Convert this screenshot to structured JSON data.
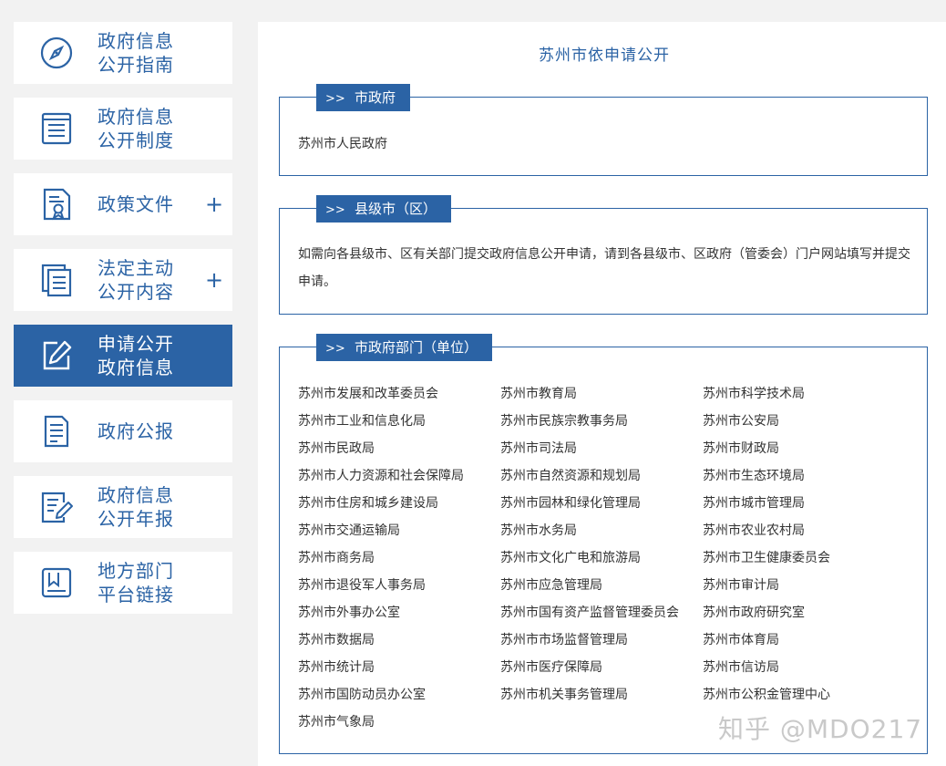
{
  "sidebar": {
    "items": [
      {
        "line1": "政府信息",
        "line2": "公开指南",
        "plus": ""
      },
      {
        "line1": "政府信息",
        "line2": "公开制度",
        "plus": ""
      },
      {
        "line1": "政策文件",
        "line2": "",
        "plus": "+"
      },
      {
        "line1": "法定主动",
        "line2": "公开内容",
        "plus": "+"
      },
      {
        "line1": "申请公开",
        "line2": "政府信息",
        "plus": ""
      },
      {
        "line1": "政府公报",
        "line2": "",
        "plus": ""
      },
      {
        "line1": "政府信息",
        "line2": "公开年报",
        "plus": ""
      },
      {
        "line1": "地方部门",
        "line2": "平台链接",
        "plus": ""
      }
    ]
  },
  "main": {
    "title": "苏州市依申请公开",
    "sections": [
      {
        "arrow": ">>",
        "label": "市政府",
        "text": "苏州市人民政府"
      },
      {
        "arrow": ">>",
        "label": "县级市（区）",
        "text": "如需向各县级市、区有关部门提交政府信息公开申请，请到各县级市、区政府（管委会）门户网站填写并提交申请。"
      },
      {
        "arrow": ">>",
        "label": "市政府部门（单位）",
        "departments": [
          "苏州市发展和改革委员会",
          "苏州市教育局",
          "苏州市科学技术局",
          "苏州市工业和信息化局",
          "苏州市民族宗教事务局",
          "苏州市公安局",
          "苏州市民政局",
          "苏州市司法局",
          "苏州市财政局",
          "苏州市人力资源和社会保障局",
          "苏州市自然资源和规划局",
          "苏州市生态环境局",
          "苏州市住房和城乡建设局",
          "苏州市园林和绿化管理局",
          "苏州市城市管理局",
          "苏州市交通运输局",
          "苏州市水务局",
          "苏州市农业农村局",
          "苏州市商务局",
          "苏州市文化广电和旅游局",
          "苏州市卫生健康委员会",
          "苏州市退役军人事务局",
          "苏州市应急管理局",
          "苏州市审计局",
          "苏州市外事办公室",
          "苏州市国有资产监督管理委员会",
          "苏州市政府研究室",
          "苏州市数据局",
          "苏州市市场监督管理局",
          "苏州市体育局",
          "苏州市统计局",
          "苏州市医疗保障局",
          "苏州市信访局",
          "苏州市国防动员办公室",
          "苏州市机关事务管理局",
          "苏州市公积金管理中心",
          "苏州市气象局"
        ]
      }
    ]
  },
  "watermark": "知乎 @MDO217",
  "colors": {
    "accent": "#2b63a5",
    "background": "#f2f2f2",
    "text": "#333333"
  }
}
